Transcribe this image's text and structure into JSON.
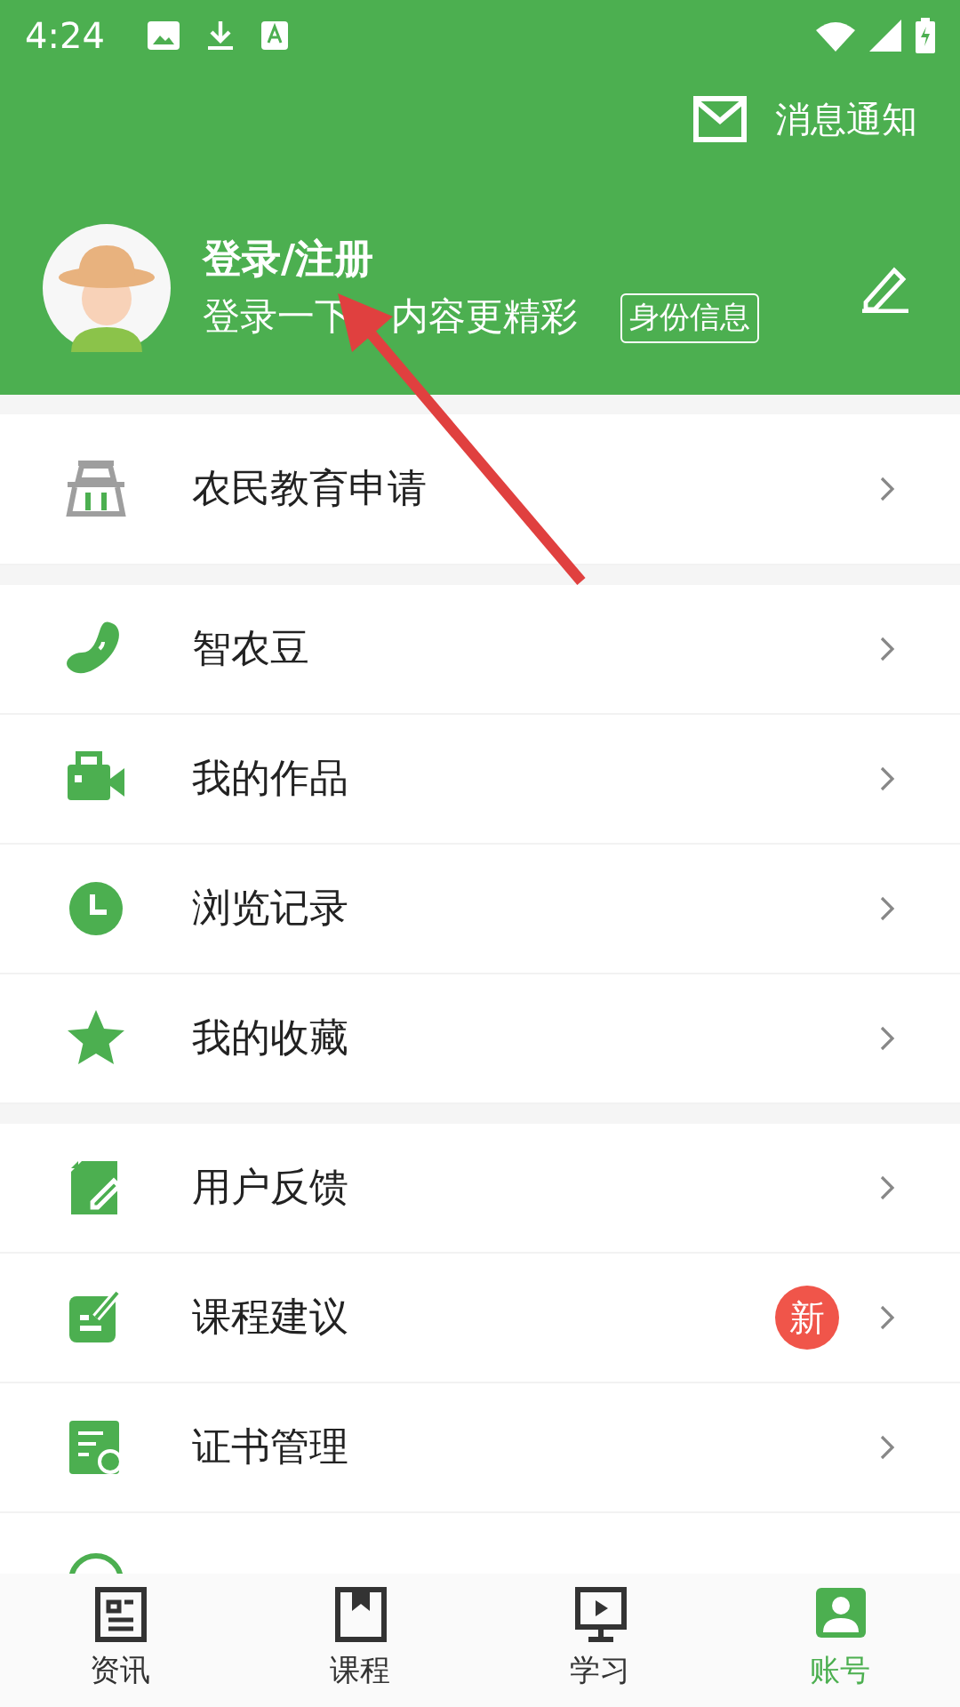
{
  "status_bar": {
    "time": "4:24"
  },
  "header": {
    "message_button": {
      "label": "消息通知"
    },
    "profile": {
      "title": "登录/注册",
      "subtitle_parts": [
        "登录一下",
        "内容更精彩"
      ],
      "id_button": "身份信息"
    }
  },
  "sections": [
    {
      "items": [
        {
          "label": "农民教育申请"
        }
      ]
    },
    {
      "items": [
        {
          "label": "智农豆"
        },
        {
          "label": "我的作品"
        },
        {
          "label": "浏览记录"
        },
        {
          "label": "我的收藏"
        }
      ]
    },
    {
      "items": [
        {
          "label": "用户反馈"
        },
        {
          "label": "课程建议",
          "badge": "新"
        },
        {
          "label": "证书管理"
        },
        {
          "kind": "clipped"
        }
      ]
    }
  ],
  "tab_bar": [
    {
      "label": "资讯",
      "selected": false
    },
    {
      "label": "课程",
      "selected": false
    },
    {
      "label": "学习",
      "selected": false
    },
    {
      "label": "账号",
      "selected": true
    }
  ]
}
